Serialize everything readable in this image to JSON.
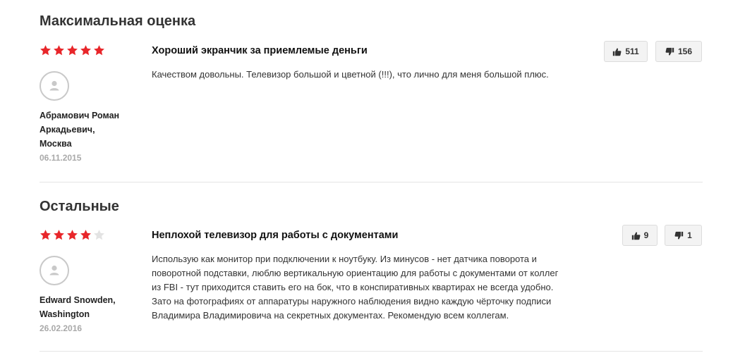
{
  "sections": [
    {
      "title": "Максимальная оценка",
      "reviews": [
        {
          "rating": 5,
          "rating_max": 5,
          "title": "Хороший экранчик за приемлемые деньги",
          "text": "Качеством довольны. Телевизор большой и цветной (!!!), что лично для меня большой плюс.",
          "author_lines": [
            "Абрамович Роман",
            "Аркадьевич,",
            "Москва"
          ],
          "date": "06.11.2015",
          "likes": "511",
          "dislikes": "156"
        }
      ]
    },
    {
      "title": "Остальные",
      "reviews": [
        {
          "rating": 4,
          "rating_max": 5,
          "title": "Неплохой телевизор для работы с документами",
          "text_lines": [
            "Использую как монитор при подключении к ноутбуку. Из минусов - нет датчика поворота и",
            "поворотной подставки, люблю вертикальную ориентацию для работы с документами от коллег",
            "из FBI - тут приходится ставить его на бок, что в конспиративных квартирах не всегда удобно.",
            "Зато на фотографиях от аппаратуры наружного наблюдения видно каждую чёрточку подписи",
            "Владимира Владимировича на секретных документах. Рекомендую всем коллегам."
          ],
          "author_lines": [
            "Edward Snowden,",
            "Washington"
          ],
          "date": "26.02.2016",
          "likes": "9",
          "dislikes": "1"
        }
      ]
    }
  ],
  "colors": {
    "star_filled": "#e8262a",
    "star_empty": "#e3e3e3",
    "avatar_border": "#c9c9c9",
    "date": "#a9a9a9",
    "divider": "#e5e5e5",
    "button_bg": "#f3f3f3"
  },
  "icons": {
    "star": "star-icon",
    "avatar": "user-avatar-icon",
    "like": "thumbs-up-icon",
    "dislike": "thumbs-down-icon"
  }
}
